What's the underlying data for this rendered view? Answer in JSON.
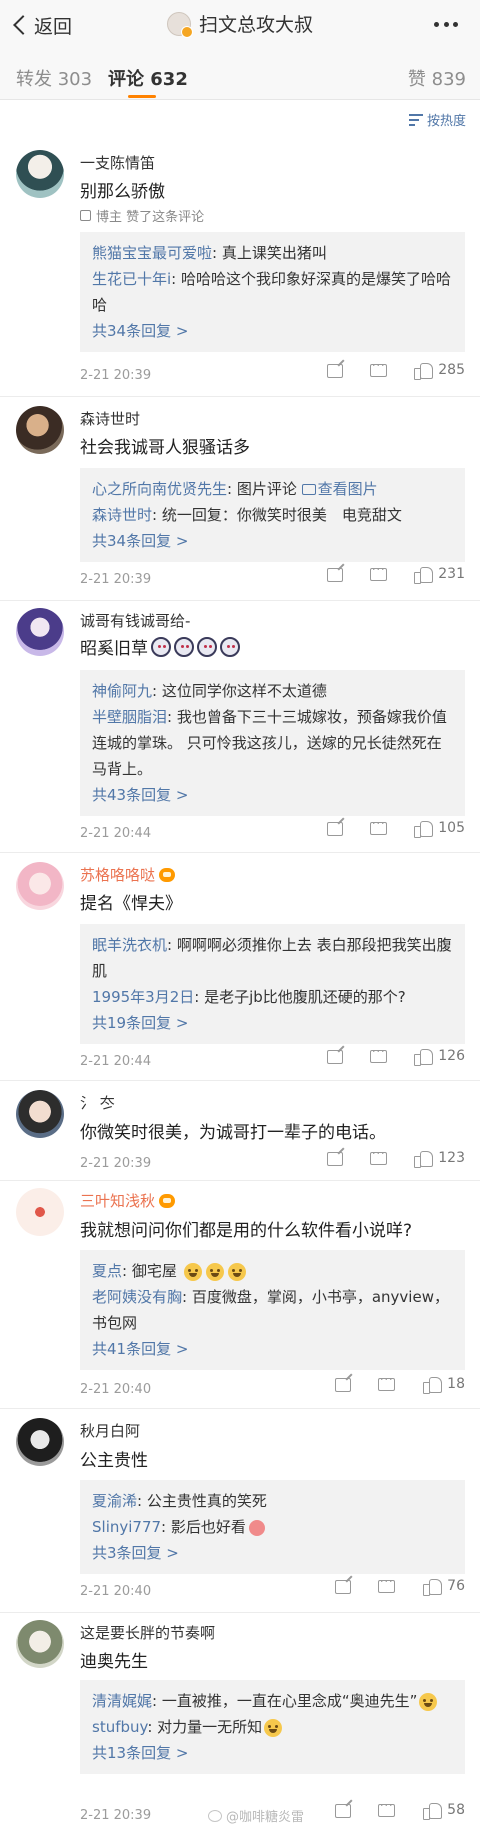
{
  "nav": {
    "back_label": "返回",
    "title": "扫文总攻大叔"
  },
  "tabs": {
    "repost": "转发 303",
    "comment": "评论 632",
    "like": "赞 839"
  },
  "sort": {
    "label": "按热度"
  },
  "comments": [
    {
      "user": "一支陈情笛",
      "text": "别那么骄傲",
      "author_like": "博主 赞了这条评论",
      "replies": [
        {
          "name": "熊猫宝宝最可爱啦",
          "text": "真上课笑出猪叫"
        },
        {
          "name": "生花已十年i",
          "text": "哈哈哈这个我印象好深真的是爆笑了哈哈哈"
        }
      ],
      "more": "共34条回复 >",
      "time": "2-21 20:39",
      "likes": "285"
    },
    {
      "user": "森诗世时",
      "text": "社会我诚哥人狠骚话多",
      "replies": [
        {
          "name": "心之所向南优贤先生",
          "text": "图片评论",
          "extra": "查看图片"
        },
        {
          "name": "森诗世时",
          "text": "统一回复：你微笑时很美　电竞甜文"
        }
      ],
      "more": "共34条回复 >",
      "time": "2-21 20:39",
      "likes": "231"
    },
    {
      "user": "诚哥有钱诚哥给-",
      "text": "昭奚旧草",
      "replies": [
        {
          "name": "神偷阿九",
          "text": "这位同学你这样不太道德"
        },
        {
          "name": "半壁胭脂泪",
          "text": "我也曾备下三十三城嫁妆，预备嫁我价值连城的掌珠。 只可怜我这孩儿，送嫁的兄长徒然死在马背上。"
        }
      ],
      "more": "共43条回复 >",
      "time": "2-21 20:44",
      "likes": "105"
    },
    {
      "user": "苏格咯咯哒",
      "text": "提名《悍夫》",
      "replies": [
        {
          "name": "眠羊洗衣机",
          "text": "啊啊啊必须推你上去 表白那段把我笑出腹肌"
        },
        {
          "name": "1995年3月2日",
          "text": "是老子jb比他腹肌还硬的那个?"
        }
      ],
      "more": "共19条回复 >",
      "time": "2-21 20:44",
      "likes": "126"
    },
    {
      "user": "氵 冭",
      "text": "你微笑时很美，为诚哥打一辈子的电话。",
      "time": "2-21 20:39",
      "likes": "123"
    },
    {
      "user": "三叶知浅秋",
      "text": "我就想问问你们都是用的什么软件看小说咩?",
      "replies": [
        {
          "name": "夏点",
          "text": "御宅屋"
        },
        {
          "name": "老阿姨没有胸",
          "text": "百度微盘，掌阅，小书亭，anyview，书包网"
        }
      ],
      "more": "共41条回复 >",
      "time": "2-21 20:40",
      "likes": "18"
    },
    {
      "user": "秋月白阿",
      "text": "公主贵性",
      "replies": [
        {
          "name": "夏渝浠",
          "text": "公主贵性真的笑死"
        },
        {
          "name": "Slinyi777",
          "text": "影后也好看"
        }
      ],
      "more": "共3条回复 >",
      "time": "2-21 20:40",
      "likes": "76"
    },
    {
      "user": "这是要长胖的节奏啊",
      "text": "迪奥先生",
      "replies": [
        {
          "name": "清清娓娓",
          "text": "一直被推，一直在心里念成“奥迪先生”"
        },
        {
          "name": "stufbuy",
          "text": "对力量一无所知"
        }
      ],
      "more": "共13条回复 >",
      "time": "2-21 20:39",
      "likes": "58"
    }
  ],
  "watermark": "@咖啡糖炎雷",
  "colors": {
    "link": "#5177a8",
    "accent": "#ff8200",
    "reply_bg": "#f2f2f2"
  }
}
